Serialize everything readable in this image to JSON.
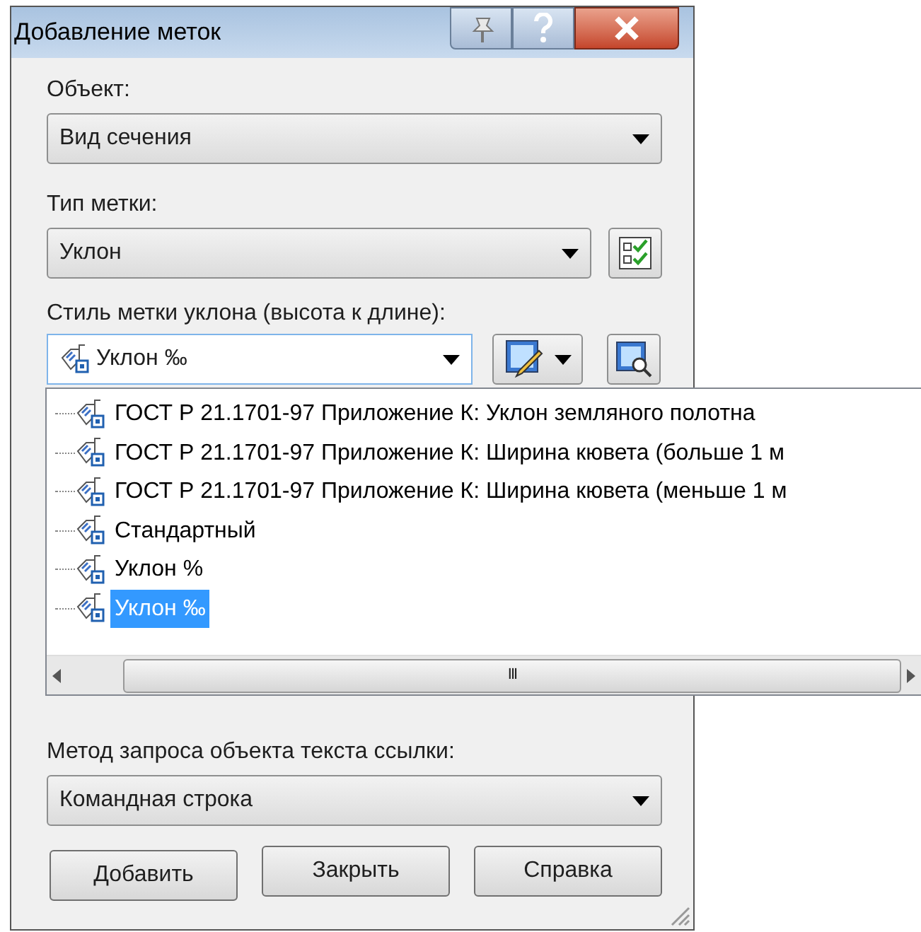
{
  "window": {
    "title": "Добавление меток"
  },
  "object": {
    "label": "Объект:",
    "value": "Вид сечения"
  },
  "label_type": {
    "label": "Тип метки:",
    "value": "Уклон"
  },
  "label_style": {
    "label": "Стиль метки уклона (высота к длине):",
    "value": "Уклон ‰",
    "expanded": true,
    "items": [
      {
        "label": "ГОСТ Р 21.1701-97 Приложение К: Уклон земляного полотна",
        "selected": false
      },
      {
        "label": "ГОСТ Р 21.1701-97 Приложение К: Ширина кювета (больше 1 м",
        "selected": false
      },
      {
        "label": "ГОСТ Р 21.1701-97 Приложение К: Ширина кювета (меньше 1 м",
        "selected": false
      },
      {
        "label": "Стандартный",
        "selected": false
      },
      {
        "label": "Уклон %",
        "selected": false
      },
      {
        "label": "Уклон ‰",
        "selected": true
      }
    ],
    "scrollbar_grip": "III"
  },
  "method": {
    "label": "Метод запроса объекта текста ссылки:",
    "value": "Командная строка"
  },
  "buttons": [
    {
      "label": "Добавить"
    },
    {
      "label": "Закрыть"
    },
    {
      "label": "Справка"
    }
  ]
}
